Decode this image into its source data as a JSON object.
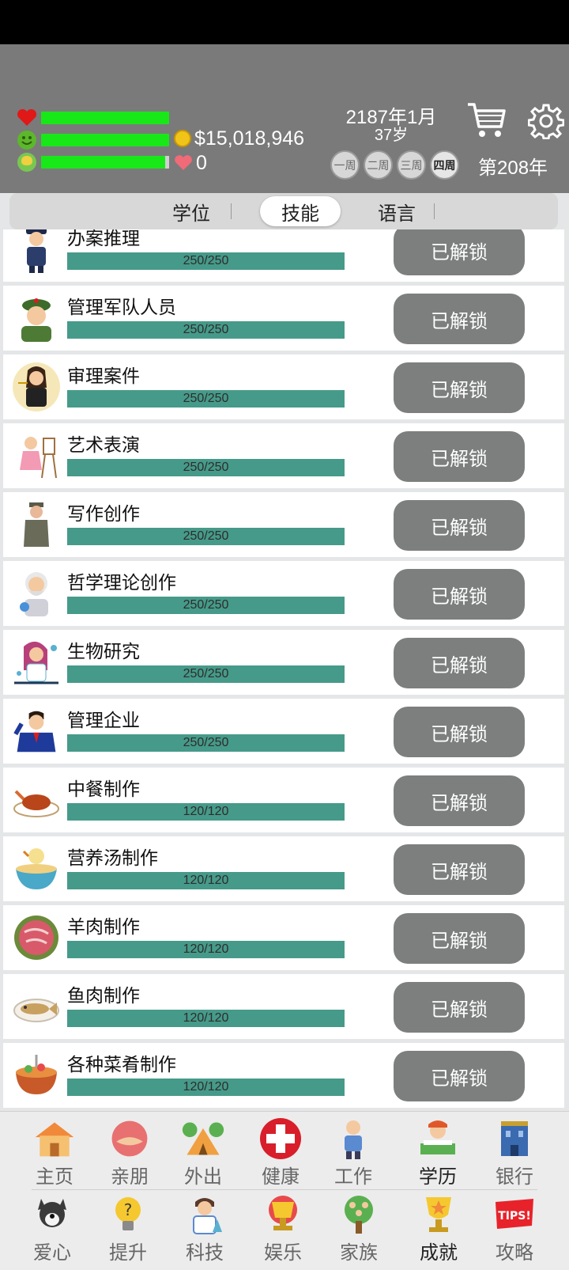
{
  "header": {
    "money": "$15,018,946",
    "hearts": "0",
    "date": "2187年1月",
    "age": "37岁",
    "weeks": [
      "一周",
      "二周",
      "三周",
      "四周"
    ],
    "active_week": "四周",
    "year_label": "第208年",
    "stats": {
      "health": 1.0,
      "happiness": 1.0,
      "intelligence": 0.97
    }
  },
  "tabs": [
    "学位",
    "技能",
    "语言"
  ],
  "active_tab": "技能",
  "skills": [
    {
      "name": "办案推理",
      "progress": "250/250",
      "button": "已解锁",
      "icon": "police-officer-icon"
    },
    {
      "name": "管理军队人员",
      "progress": "250/250",
      "button": "已解锁",
      "icon": "soldier-icon"
    },
    {
      "name": "审理案件",
      "progress": "250/250",
      "button": "已解锁",
      "icon": "judge-icon"
    },
    {
      "name": "艺术表演",
      "progress": "250/250",
      "button": "已解锁",
      "icon": "artist-icon"
    },
    {
      "name": "写作创作",
      "progress": "250/250",
      "button": "已解锁",
      "icon": "writer-icon"
    },
    {
      "name": "哲学理论创作",
      "progress": "250/250",
      "button": "已解锁",
      "icon": "philosopher-icon"
    },
    {
      "name": "生物研究",
      "progress": "250/250",
      "button": "已解锁",
      "icon": "scientist-icon"
    },
    {
      "name": "管理企业",
      "progress": "250/250",
      "button": "已解锁",
      "icon": "businessman-icon"
    },
    {
      "name": "中餐制作",
      "progress": "120/120",
      "button": "已解锁",
      "icon": "chinese-dish-icon"
    },
    {
      "name": "营养汤制作",
      "progress": "120/120",
      "button": "已解锁",
      "icon": "soup-icon"
    },
    {
      "name": "羊肉制作",
      "progress": "120/120",
      "button": "已解锁",
      "icon": "mutton-icon"
    },
    {
      "name": "鱼肉制作",
      "progress": "120/120",
      "button": "已解锁",
      "icon": "fish-dish-icon"
    },
    {
      "name": "各种菜肴制作",
      "progress": "120/120",
      "button": "已解锁",
      "icon": "hotpot-icon"
    }
  ],
  "nav_row1": [
    {
      "label": "主页",
      "icon": "home-icon"
    },
    {
      "label": "亲朋",
      "icon": "handshake-icon"
    },
    {
      "label": "外出",
      "icon": "tent-icon"
    },
    {
      "label": "健康",
      "icon": "medical-cross-icon"
    },
    {
      "label": "工作",
      "icon": "worker-icon"
    },
    {
      "label": "学历",
      "icon": "study-icon"
    },
    {
      "label": "银行",
      "icon": "bank-icon"
    }
  ],
  "nav_row2": [
    {
      "label": "爱心",
      "icon": "dog-icon"
    },
    {
      "label": "提升",
      "icon": "lightbulb-icon"
    },
    {
      "label": "科技",
      "icon": "scientist-icon"
    },
    {
      "label": "娱乐",
      "icon": "trophy-cup-icon"
    },
    {
      "label": "家族",
      "icon": "family-tree-icon"
    },
    {
      "label": "成就",
      "icon": "achievement-icon"
    },
    {
      "label": "攻略",
      "icon": "tips-icon"
    }
  ]
}
